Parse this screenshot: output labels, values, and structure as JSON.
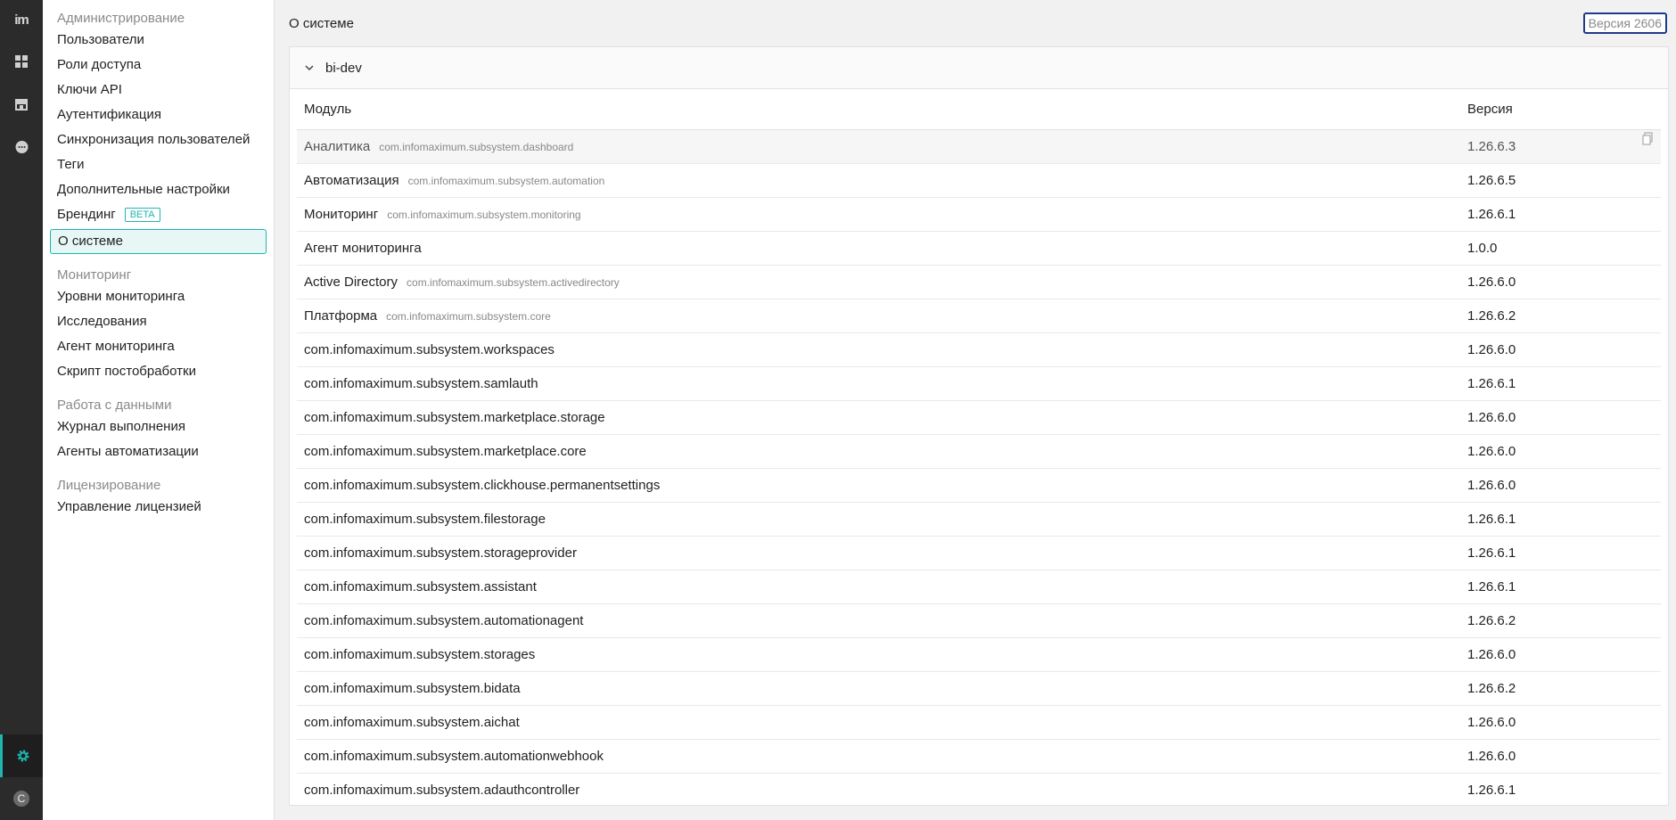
{
  "rail": {
    "logo": "im",
    "avatar_letter": "C"
  },
  "sidebar": {
    "sections": [
      {
        "title": "Администрирование",
        "items": [
          {
            "label": "Пользователи"
          },
          {
            "label": "Роли доступа"
          },
          {
            "label": "Ключи API"
          },
          {
            "label": "Аутентификация"
          },
          {
            "label": "Синхронизация пользователей"
          },
          {
            "label": "Теги"
          },
          {
            "label": "Дополнительные настройки"
          },
          {
            "label": "Брендинг",
            "badge": "BETA"
          },
          {
            "label": "О системе",
            "active": true
          }
        ]
      },
      {
        "title": "Мониторинг",
        "items": [
          {
            "label": "Уровни мониторинга"
          },
          {
            "label": "Исследования"
          },
          {
            "label": "Агент мониторинга"
          },
          {
            "label": "Скрипт постобработки"
          }
        ]
      },
      {
        "title": "Работа с данными",
        "items": [
          {
            "label": "Журнал выполнения"
          },
          {
            "label": "Агенты автоматизации"
          }
        ]
      },
      {
        "title": "Лицензирование",
        "items": [
          {
            "label": "Управление лицензией"
          }
        ]
      }
    ]
  },
  "header": {
    "title": "О системе",
    "version_button": "Версия 2606"
  },
  "panel": {
    "group_name": "bi-dev",
    "columns": {
      "module": "Модуль",
      "version": "Версия"
    },
    "rows": [
      {
        "name": "Аналитика",
        "id": "com.infomaximum.subsystem.dashboard",
        "version": "1.26.6.3",
        "hover": true
      },
      {
        "name": "Автоматизация",
        "id": "com.infomaximum.subsystem.automation",
        "version": "1.26.6.5"
      },
      {
        "name": "Мониторинг",
        "id": "com.infomaximum.subsystem.monitoring",
        "version": "1.26.6.1"
      },
      {
        "name": "Агент мониторинга",
        "id": "",
        "version": "1.0.0"
      },
      {
        "name": "Active Directory",
        "id": "com.infomaximum.subsystem.activedirectory",
        "version": "1.26.6.0"
      },
      {
        "name": "Платформа",
        "id": "com.infomaximum.subsystem.core",
        "version": "1.26.6.2"
      },
      {
        "name": "com.infomaximum.subsystem.workspaces",
        "id": "",
        "version": "1.26.6.0"
      },
      {
        "name": "com.infomaximum.subsystem.samlauth",
        "id": "",
        "version": "1.26.6.1"
      },
      {
        "name": "com.infomaximum.subsystem.marketplace.storage",
        "id": "",
        "version": "1.26.6.0"
      },
      {
        "name": "com.infomaximum.subsystem.marketplace.core",
        "id": "",
        "version": "1.26.6.0"
      },
      {
        "name": "com.infomaximum.subsystem.clickhouse.permanentsettings",
        "id": "",
        "version": "1.26.6.0"
      },
      {
        "name": "com.infomaximum.subsystem.filestorage",
        "id": "",
        "version": "1.26.6.1"
      },
      {
        "name": "com.infomaximum.subsystem.storageprovider",
        "id": "",
        "version": "1.26.6.1"
      },
      {
        "name": "com.infomaximum.subsystem.assistant",
        "id": "",
        "version": "1.26.6.1"
      },
      {
        "name": "com.infomaximum.subsystem.automationagent",
        "id": "",
        "version": "1.26.6.2"
      },
      {
        "name": "com.infomaximum.subsystem.storages",
        "id": "",
        "version": "1.26.6.0"
      },
      {
        "name": "com.infomaximum.subsystem.bidata",
        "id": "",
        "version": "1.26.6.2"
      },
      {
        "name": "com.infomaximum.subsystem.aichat",
        "id": "",
        "version": "1.26.6.0"
      },
      {
        "name": "com.infomaximum.subsystem.automationwebhook",
        "id": "",
        "version": "1.26.6.0"
      },
      {
        "name": "com.infomaximum.subsystem.adauthcontroller",
        "id": "",
        "version": "1.26.6.1"
      }
    ]
  },
  "colors": {
    "accent": "#1fb5b0",
    "rail_bg": "#2b2b2b",
    "version_border": "#1f3a8a"
  },
  "icons": {
    "rail_top": [
      "dashboard-icon",
      "store-icon",
      "chat-icon"
    ],
    "rail_bottom": [
      "settings-icon",
      "avatar"
    ],
    "panel": [
      "chevron-down-icon",
      "copy-icon"
    ]
  }
}
